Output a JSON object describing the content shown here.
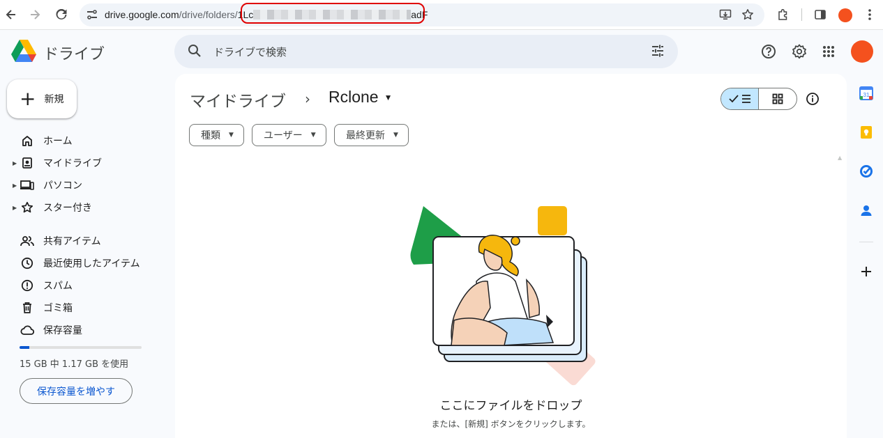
{
  "browser": {
    "url_host": "drive.google.com",
    "url_path": "/drive/folders/",
    "url_id_start": "1Lc",
    "url_id_end": "adF"
  },
  "app": {
    "title": "ドライブ"
  },
  "search": {
    "placeholder": "ドライブで検索"
  },
  "sidebar": {
    "new_label": "新規",
    "items": [
      {
        "label": "ホーム"
      },
      {
        "label": "マイドライブ"
      },
      {
        "label": "パソコン"
      },
      {
        "label": "スター付き"
      },
      {
        "label": "共有アイテム"
      },
      {
        "label": "最近使用したアイテム"
      },
      {
        "label": "スパム"
      },
      {
        "label": "ゴミ箱"
      },
      {
        "label": "保存容量"
      }
    ],
    "storage_used_fraction": 0.078,
    "storage_text": "15 GB 中 1.17 GB を使用",
    "storage_button": "保存容量を増やす"
  },
  "breadcrumb": {
    "root": "マイドライブ",
    "separator": "›",
    "current": "Rclone"
  },
  "filters": [
    {
      "label": "種類"
    },
    {
      "label": "ユーザー"
    },
    {
      "label": "最終更新"
    }
  ],
  "empty_state": {
    "title": "ここにファイルをドロップ",
    "subtitle": "または、[新規] ボタンをクリックします。"
  },
  "side_panel": {
    "calendar_day": "31"
  },
  "colors": {
    "accent": "#0b57d0",
    "selected_view": "#c2e7ff",
    "avatar": "#f4511e",
    "highlight": "#e00000"
  }
}
